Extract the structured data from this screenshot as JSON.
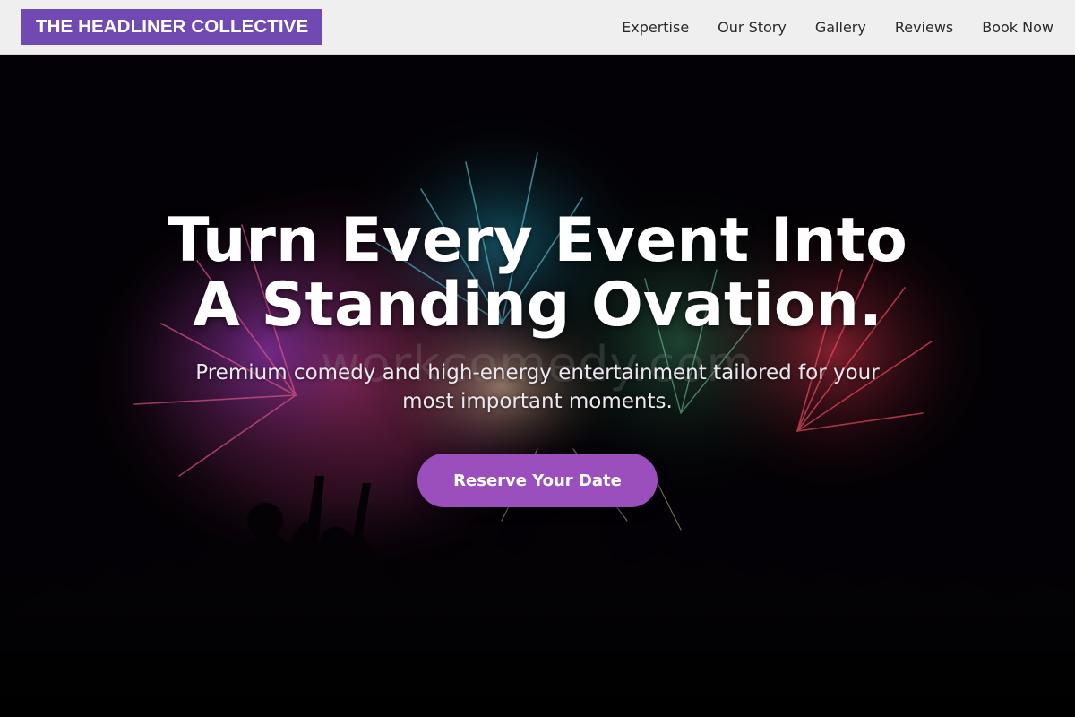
{
  "header": {
    "logo": "THE HEADLINER COLLECTIVE",
    "nav": [
      {
        "label": "Expertise"
      },
      {
        "label": "Our Story"
      },
      {
        "label": "Gallery"
      },
      {
        "label": "Reviews"
      },
      {
        "label": "Book Now"
      }
    ]
  },
  "hero": {
    "title_line1": "Turn Every Event Into",
    "title_line2": "A Standing Ovation.",
    "watermark": "workcomedy.com",
    "subtitle": "Premium comedy and high-energy entertainment tailored for your most important moments.",
    "cta_label": "Reserve Your Date",
    "background": "fireworks-crowd-photo"
  },
  "colors": {
    "logo_bg": "#7049b3",
    "cta_bg": "#9b4fbc",
    "header_bg": "#f0eff0",
    "hero_bg": "#020103"
  }
}
